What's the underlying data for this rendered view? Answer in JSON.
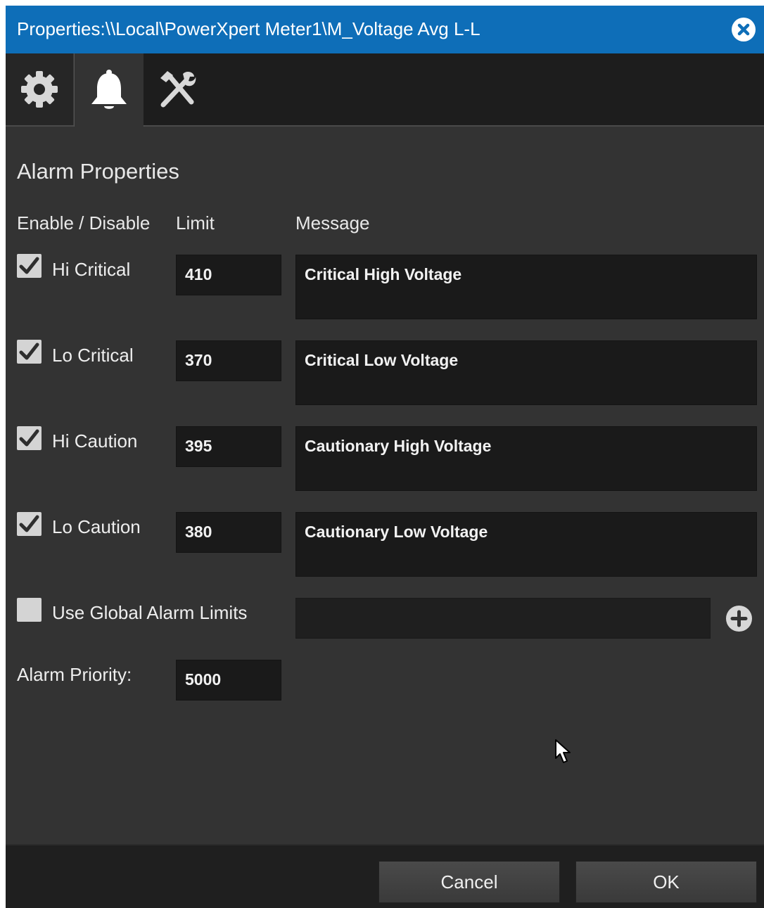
{
  "window": {
    "title": "Properties:\\\\Local\\PowerXpert Meter1\\M_Voltage Avg L-L"
  },
  "tabs": [
    {
      "name": "general",
      "icon": "gear-icon",
      "selected": false
    },
    {
      "name": "alarm",
      "icon": "bell-icon",
      "selected": true
    },
    {
      "name": "tools",
      "icon": "tools-icon",
      "selected": false
    }
  ],
  "section": {
    "title": "Alarm Properties",
    "col_enable": "Enable / Disable",
    "col_limit": "Limit",
    "col_message": "Message"
  },
  "alarms": [
    {
      "label": "Hi Critical",
      "checked": true,
      "limit": "410",
      "message": "Critical High Voltage"
    },
    {
      "label": "Lo Critical",
      "checked": true,
      "limit": "370",
      "message": "Critical Low Voltage"
    },
    {
      "label": "Hi Caution",
      "checked": true,
      "limit": "395",
      "message": "Cautionary High Voltage"
    },
    {
      "label": "Lo Caution",
      "checked": true,
      "limit": "380",
      "message": "Cautionary Low Voltage"
    }
  ],
  "global_limits": {
    "label": "Use Global Alarm Limits",
    "checked": false,
    "value": ""
  },
  "priority": {
    "label": "Alarm Priority:",
    "value": "5000"
  },
  "buttons": {
    "cancel": "Cancel",
    "ok": "OK"
  },
  "colors": {
    "title_bar": "#0e6eb8",
    "panel": "#333333",
    "input_bg": "#1a1a1a"
  }
}
